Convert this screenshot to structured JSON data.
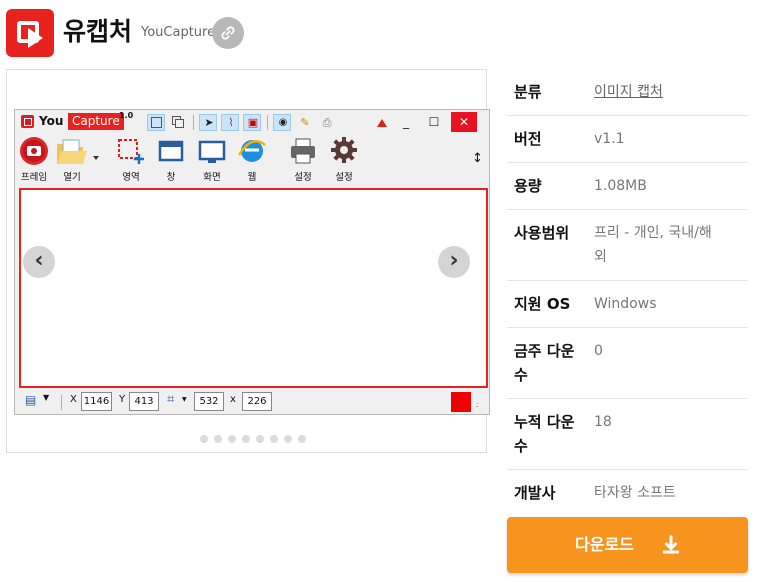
{
  "app": {
    "title": "유캡처",
    "subtitle": "YouCapture"
  },
  "screenshot": {
    "window_name": "You",
    "window_name_highlight": "Capture",
    "version": "1.0",
    "tools": [
      {
        "label": "프레임",
        "icon": "record-frame-icon"
      },
      {
        "label": "열기",
        "icon": "open-folder-icon"
      },
      {
        "label": "영역",
        "icon": "region-select-icon"
      },
      {
        "label": "창",
        "icon": "window-capture-icon"
      },
      {
        "label": "화면",
        "icon": "screen-capture-icon"
      },
      {
        "label": "웹",
        "icon": "web-browser-icon"
      },
      {
        "label": "설정",
        "icon": "printer-icon"
      },
      {
        "label": "설정",
        "icon": "settings-gear-icon"
      }
    ],
    "status": {
      "x_label": "X",
      "x_value": "1146",
      "y_label": "Y",
      "y_value": "413",
      "w_value": "532",
      "by_label": "x",
      "h_value": "226",
      "color_swatch": "#ee0000"
    },
    "carousel_dot_count": 8
  },
  "info": {
    "rows": [
      {
        "key": "분류",
        "value": "이미지 캡처",
        "is_link": true
      },
      {
        "key": "버전",
        "value": "v1.1"
      },
      {
        "key": "용량",
        "value": "1.08MB"
      },
      {
        "key": "사용범위",
        "value_line1": "프리 - 개인, 국내/해",
        "value_line2": "외"
      },
      {
        "key": "지원 OS",
        "value": "Windows"
      },
      {
        "key_line1": "금주 다운",
        "key_line2": "수",
        "value": "0"
      },
      {
        "key_line1": "누적 다운",
        "key_line2": "수",
        "value": "18"
      },
      {
        "key": "개발사",
        "value": "타자왕 소프트"
      }
    ]
  },
  "download": {
    "label": "다운로드",
    "color": "#f7941d"
  }
}
